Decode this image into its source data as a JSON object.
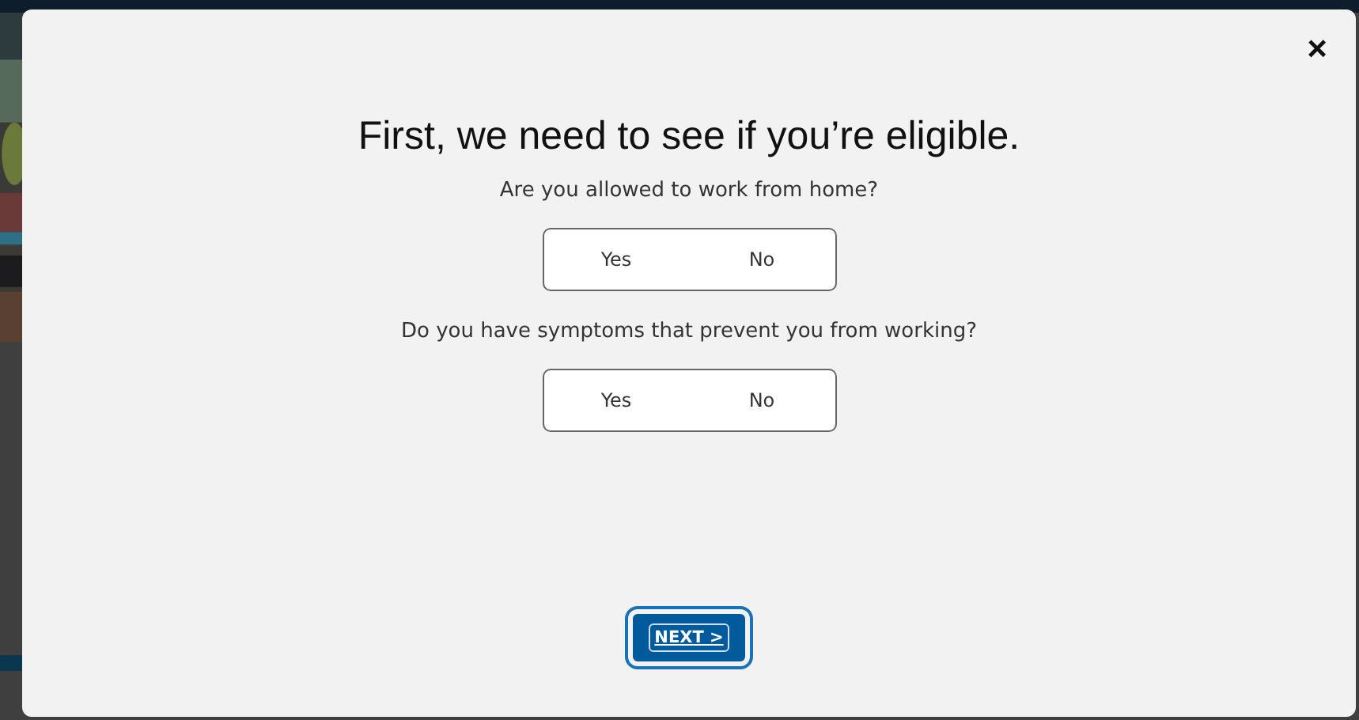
{
  "modal": {
    "close": "×",
    "title": "First, we need to see if you’re eligible.",
    "questions": [
      {
        "text": "Are you allowed to work from home?",
        "options": [
          {
            "label": "Yes",
            "selected": false
          },
          {
            "label": "No",
            "selected": false
          }
        ]
      },
      {
        "text": "Do you have symptoms that prevent you from working?",
        "options": [
          {
            "label": "Yes",
            "selected": false
          },
          {
            "label": "No",
            "selected": false
          }
        ]
      }
    ],
    "next_button": "NEXT >"
  }
}
